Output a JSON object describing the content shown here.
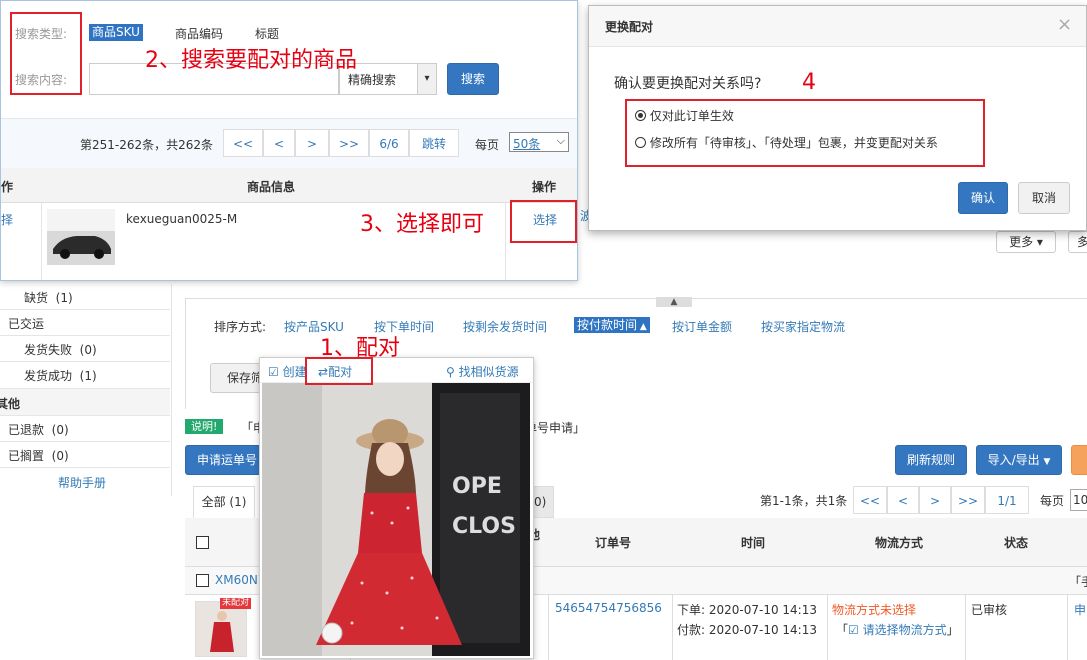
{
  "search_panel": {
    "type_label": "搜索类型:",
    "types": [
      "商品SKU",
      "商品编码",
      "标题"
    ],
    "content_label": "搜索内容:",
    "search_input_value": "",
    "match_select": "精确搜索",
    "search_button": "搜索",
    "pagination": {
      "summary": "第251-262条，共262条",
      "first": "<<",
      "prev": "<",
      "next": ">",
      "last": ">>",
      "current": "6/6",
      "jump": "跳转",
      "per_page_label": "每页",
      "per_page_value": "50条"
    },
    "table": {
      "col_op_left": "作",
      "col_info": "商品信息",
      "col_op": "操作",
      "row_left": "择",
      "product_sku": "kexueguan0025-M",
      "select_link": "选择",
      "extra": "波"
    }
  },
  "dialog": {
    "title": "更换配对",
    "close": "×",
    "question": "确认要更换配对关系吗?",
    "option1": "仅对此订单生效",
    "option2": "修改所有「待审核」、「待处理」包裹，并变更配对关系",
    "confirm": "确认",
    "cancel": "取消"
  },
  "annotations": {
    "a1": "1、配对",
    "a2": "2、搜索要配对的商品",
    "a3": "3、选择即可",
    "a4": "4"
  },
  "sidebar": {
    "items": [
      {
        "label": "缺货",
        "count": "(1)"
      },
      {
        "label": "已交运",
        "count": ""
      },
      {
        "label": "发货失败",
        "count": "(0)"
      },
      {
        "label": "发货成功",
        "count": "(1)"
      },
      {
        "label": "其他",
        "count": ""
      },
      {
        "label": "已退款",
        "count": "(0)"
      },
      {
        "label": "已搁置",
        "count": "(0)"
      }
    ],
    "help": "帮助手册"
  },
  "main": {
    "more": "更多",
    "more2": "多",
    "sort_label": "排序方式:",
    "sort_options": [
      "按产品SKU",
      "按下单时间",
      "按剩余发货时间",
      "按付款时间",
      "按订单金额",
      "按买家指定物流"
    ],
    "save_filter": "保存筛",
    "notice_tag": "说明!",
    "notice_text_left": "「申",
    "notice_text_right": "单号申请」",
    "apply_button": "申请运单号",
    "refresh_button": "刷新规则",
    "import_export": "导入/导出",
    "tab_all": "全部 (1)",
    "tab_hidden": "0)",
    "pagination": {
      "summary": "第1-1条，共1条",
      "first": "<<",
      "prev": "<",
      "next": ">",
      "last": ">>",
      "current": "1/1",
      "per_page_label": "每页",
      "per_page_value": "10"
    },
    "columns": {
      "c_hidden": "他",
      "order_no": "订单号",
      "time": "时间",
      "logistics": "物流方式",
      "status": "状态"
    },
    "group_label": "XM60N7",
    "group_right": "「手",
    "order": {
      "badge": "未配对",
      "order_no": "54654754756856",
      "order_time": "下单: 2020-07-10 14:13",
      "pay_time": "付款: 2020-07-10 14:13",
      "logistics_warn": "物流方式未选择",
      "logistics_link": "请选择物流方式",
      "status": "已审核",
      "right_link": "申"
    }
  },
  "popover": {
    "create": "创建",
    "pair": "配对",
    "find_similar": "找相似货源"
  }
}
